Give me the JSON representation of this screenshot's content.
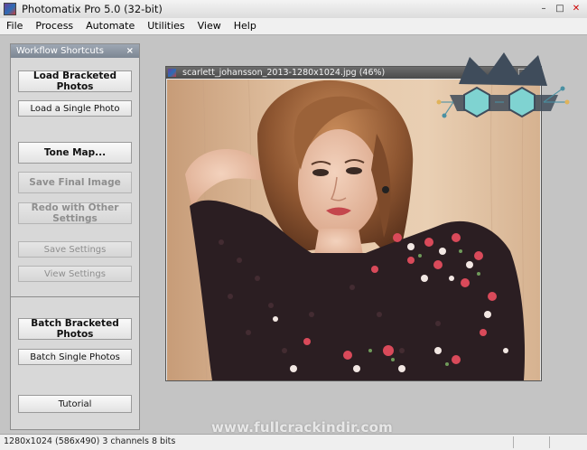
{
  "window": {
    "title": "Photomatix Pro 5.0 (32-bit)",
    "minimize": "–",
    "maximize": "□",
    "close": "✕"
  },
  "menu": [
    "File",
    "Process",
    "Automate",
    "Utilities",
    "View",
    "Help"
  ],
  "panel": {
    "title": "Workflow Shortcuts",
    "close": "×",
    "buttons": {
      "load_bracketed": "Load Bracketed Photos",
      "load_single": "Load a Single Photo",
      "tone_map": "Tone Map...",
      "save_final": "Save Final Image",
      "redo": "Redo with Other Settings",
      "save_settings": "Save Settings",
      "view_settings": "View Settings",
      "batch_bracketed": "Batch Bracketed Photos",
      "batch_single": "Batch Single Photos",
      "tutorial": "Tutorial"
    }
  },
  "image_window": {
    "title": "scarlett_johansson_2013-1280x1024.jpg (46%)",
    "minimize": "–",
    "maximize": "□",
    "close": "✕"
  },
  "watermark": "www.fullcrackindir.com",
  "status": {
    "text": "1280x1024 (586x490) 3 channels 8 bits"
  },
  "colors": {
    "panel_header": "#8a939f",
    "image_title_bar": "#555555",
    "logo_teal": "#5bc7c9",
    "logo_dark": "#3a4a5a"
  }
}
